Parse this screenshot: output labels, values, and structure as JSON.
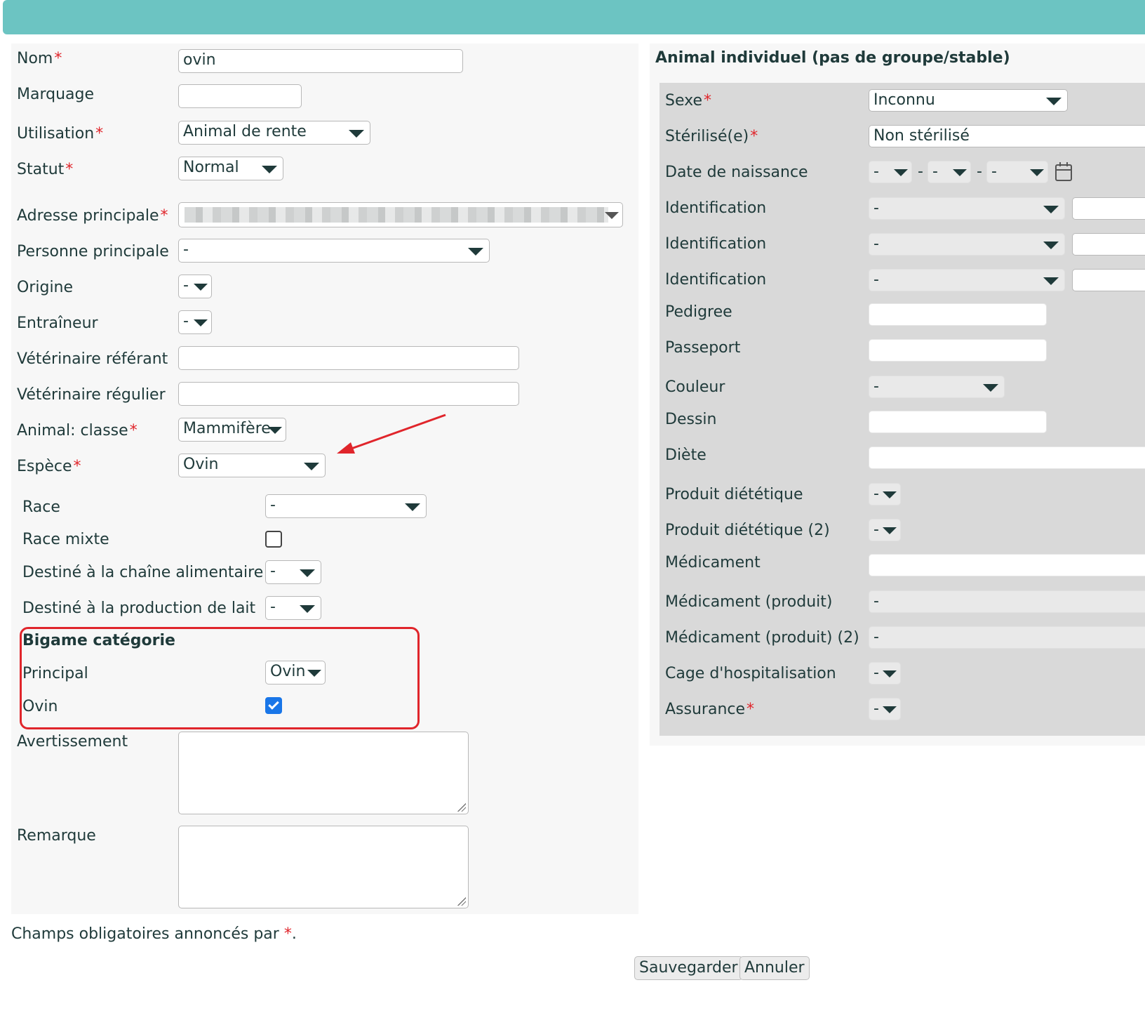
{
  "form": {
    "nom": {
      "label": "Nom",
      "value": "ovin"
    },
    "marquage": {
      "label": "Marquage",
      "value": ""
    },
    "utilisation": {
      "label": "Utilisation",
      "value": "Animal de rente"
    },
    "statut": {
      "label": "Statut",
      "value": "Normal"
    },
    "adresse": {
      "label": "Adresse principale"
    },
    "personne": {
      "label": "Personne principale",
      "value": "-"
    },
    "origine": {
      "label": "Origine",
      "value": "-"
    },
    "entraineur": {
      "label": "Entraîneur",
      "value": "-"
    },
    "vet_referant": {
      "label": "Vétérinaire référant",
      "value": ""
    },
    "vet_regulier": {
      "label": "Vétérinaire régulier",
      "value": ""
    },
    "classe": {
      "label": "Animal: classe",
      "value": "Mammifère"
    },
    "espece": {
      "label": "Espèce",
      "value": "Ovin"
    },
    "race": {
      "label": "Race",
      "value": "-"
    },
    "race_mixte": {
      "label": "Race mixte",
      "checked": false
    },
    "chaine_alim": {
      "label": "Destiné à la chaîne alimentaire",
      "value": "-"
    },
    "prod_lait": {
      "label": "Destiné à la production de lait",
      "value": "-"
    },
    "bigame": {
      "title": "Bigame catégorie",
      "principal_label": "Principal",
      "principal_value": "Ovin",
      "ovin_label": "Ovin",
      "ovin_checked": true
    },
    "avertissement": {
      "label": "Avertissement",
      "value": ""
    },
    "remarque": {
      "label": "Remarque",
      "value": ""
    },
    "required_marker": "*"
  },
  "right": {
    "title": "Animal individuel (pas de groupe/stable)",
    "sexe": {
      "label": "Sexe",
      "value": "Inconnu"
    },
    "sterilise": {
      "label": "Stérilisé(e)",
      "value": "Non stérilisé"
    },
    "naissance": {
      "label": "Date de naissance",
      "day": "-",
      "month": "-",
      "year": "-",
      "sep": "-"
    },
    "identification_label": "Identification",
    "identification_values": [
      "-",
      "-",
      "-"
    ],
    "pedigree": {
      "label": "Pedigree",
      "value": ""
    },
    "passeport": {
      "label": "Passeport",
      "value": ""
    },
    "couleur": {
      "label": "Couleur",
      "value": "-"
    },
    "dessin": {
      "label": "Dessin",
      "value": ""
    },
    "diete": {
      "label": "Diète",
      "value": ""
    },
    "produit_diet": {
      "label": "Produit diététique",
      "value": "-"
    },
    "produit_diet2": {
      "label": "Produit diététique (2)",
      "value": "-"
    },
    "medicament": {
      "label": "Médicament",
      "value": ""
    },
    "med_produit": {
      "label": "Médicament (produit)",
      "value": "-"
    },
    "med_produit2": {
      "label": "Médicament (produit) (2)",
      "value": "-"
    },
    "cage": {
      "label": "Cage d'hospitalisation",
      "value": "-"
    },
    "assurance": {
      "label": "Assurance",
      "value": "-"
    }
  },
  "footer": {
    "note": "Champs obligatoires annoncés par",
    "note_star": "*",
    "note_end": ".",
    "save": "Sauvegarder",
    "cancel": "Annuler"
  },
  "colors": {
    "header": "#6cc4c2",
    "required": "#e0252b",
    "annotation": "#e0252b",
    "checkbox": "#1976e8"
  },
  "annotations": {
    "arrow": "red-arrow pointing to Espèce field",
    "highlight_box": "red rounded box around Bigame catégorie"
  }
}
